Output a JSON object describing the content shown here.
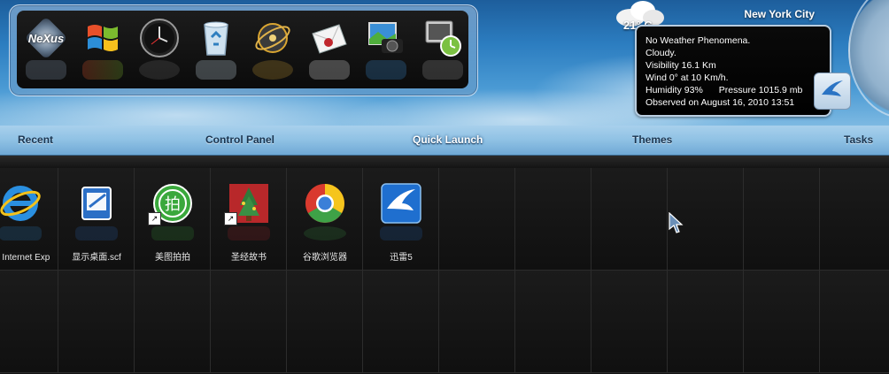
{
  "dock": {
    "items": [
      {
        "name": "nexus-logo-icon",
        "label": "NeXus"
      },
      {
        "name": "windows-icon"
      },
      {
        "name": "clock-icon"
      },
      {
        "name": "recycle-bin-icon"
      },
      {
        "name": "network-globe-icon"
      },
      {
        "name": "mail-icon"
      },
      {
        "name": "photo-camera-icon"
      },
      {
        "name": "system-clock-icon"
      }
    ]
  },
  "weather": {
    "temperature": "21° C",
    "city": "New York City",
    "lines": {
      "phenomena": "No Weather Phenomena.",
      "sky": "Cloudy.",
      "visibility": "Visibility 16.1 Km",
      "wind": "Wind 0° at 10 Km/h.",
      "humidity": "Humidity 93%",
      "pressure": "Pressure 1015.9 mb",
      "observed": "Observed on August 16, 2010 13:51"
    }
  },
  "nav": {
    "recent": "Recent",
    "control_panel": "Control Panel",
    "quick_launch": "Quick Launch",
    "themes": "Themes",
    "tasks": "Tasks"
  },
  "apps": [
    {
      "label": "动 Internet Exp",
      "icon": "internet-explorer-icon"
    },
    {
      "label": "显示桌面.scf",
      "icon": "show-desktop-icon"
    },
    {
      "label": "美图拍拍",
      "icon": "meitu-paipai-icon"
    },
    {
      "label": "圣经故书",
      "icon": "bible-book-icon"
    },
    {
      "label": "谷歌浏览器",
      "icon": "chrome-icon"
    },
    {
      "label": "迅雷5",
      "icon": "xunlei-icon"
    }
  ]
}
